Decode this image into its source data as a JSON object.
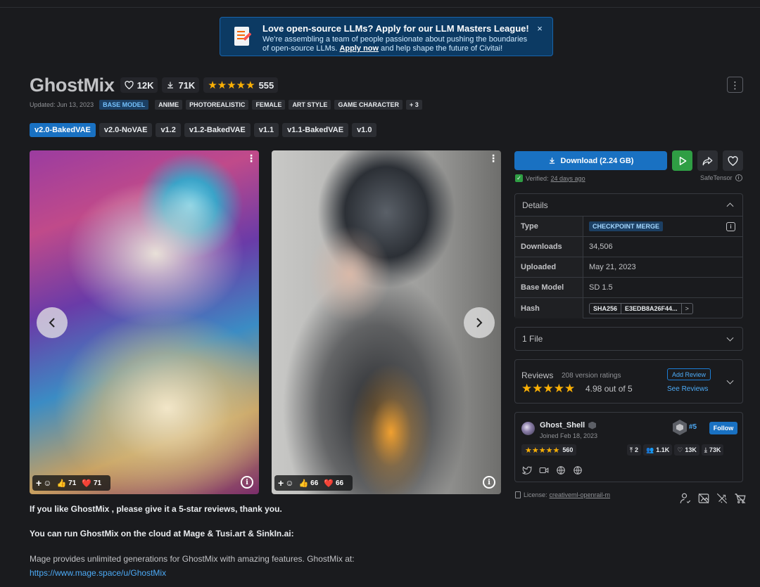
{
  "banner": {
    "title": "Love open-source LLMs? Apply for our LLM Masters League!",
    "body_before": "We're assembling a team of people passionate about pushing the boundaries of open-source LLMs. ",
    "link": "Apply now",
    "body_after": " and help shape the future of Civitai!",
    "close": "×"
  },
  "model": {
    "title": "GhostMix",
    "likes": "12K",
    "downloads": "71K",
    "stars": "★★★★★",
    "rating_count": "555",
    "updated": "Updated: Jun 13, 2023",
    "base_tag": "BASE MODEL",
    "tags": [
      "ANIME",
      "PHOTOREALISTIC",
      "FEMALE",
      "ART STYLE",
      "GAME CHARACTER",
      "+ 3"
    ]
  },
  "versions": [
    "v2.0-BakedVAE",
    "v2.0-NoVAE",
    "v1.2",
    "v1.2-BakedVAE",
    "v1.1",
    "v1.1-BakedVAE",
    "v1.0"
  ],
  "images": [
    {
      "plus": "+",
      "smile": "☺",
      "thumbs": "71",
      "hearts": "71"
    },
    {
      "plus": "+",
      "smile": "☺",
      "thumbs": "66",
      "hearts": "66"
    }
  ],
  "actions": {
    "download": "Download (2.24 GB)",
    "verified_label": "Verified:",
    "verified_when": "24 days ago",
    "safetensor": "SafeTensor"
  },
  "details": {
    "title": "Details",
    "rows": [
      {
        "key": "Type",
        "value": "CHECKPOINT MERGE"
      },
      {
        "key": "Downloads",
        "value": "34,506"
      },
      {
        "key": "Uploaded",
        "value": "May 21, 2023"
      },
      {
        "key": "Base Model",
        "value": "SD 1.5"
      },
      {
        "key": "Hash",
        "value": "SHA256",
        "hash": "E3EDB8A26F44...",
        "arrow": ">"
      }
    ]
  },
  "files": {
    "label": "1 File"
  },
  "reviews": {
    "label": "Reviews",
    "count": "208 version ratings",
    "stars": "★★★★★",
    "avg": "4.98 out of 5",
    "add": "Add Review",
    "see": "See Reviews"
  },
  "creator": {
    "name": "Ghost_Shell",
    "joined": "Joined Feb 18, 2023",
    "rank": "#5",
    "follow": "Follow",
    "stars": "★★★★★",
    "rating": "560",
    "uploads": "2",
    "followers": "1.1K",
    "likes": "13K",
    "downloads": "73K"
  },
  "license": {
    "label": "License:",
    "value": "creativeml-openrail-m"
  },
  "description": {
    "p1": "If you like GhostMix , please give it a 5-star reviews, thank you.",
    "p2": "You can run GhostMix on the cloud at Mage & Tusi.art & SinkIn.ai:",
    "p3": "Mage provides unlimited generations for GhostMix with amazing features. GhostMix at:",
    "p4": "https://www.mage.space/u/GhostMix"
  },
  "colors": {
    "accent": "#1971c2",
    "run": "#2f9e44",
    "star": "#fab005",
    "background": "#1a1b1e"
  }
}
